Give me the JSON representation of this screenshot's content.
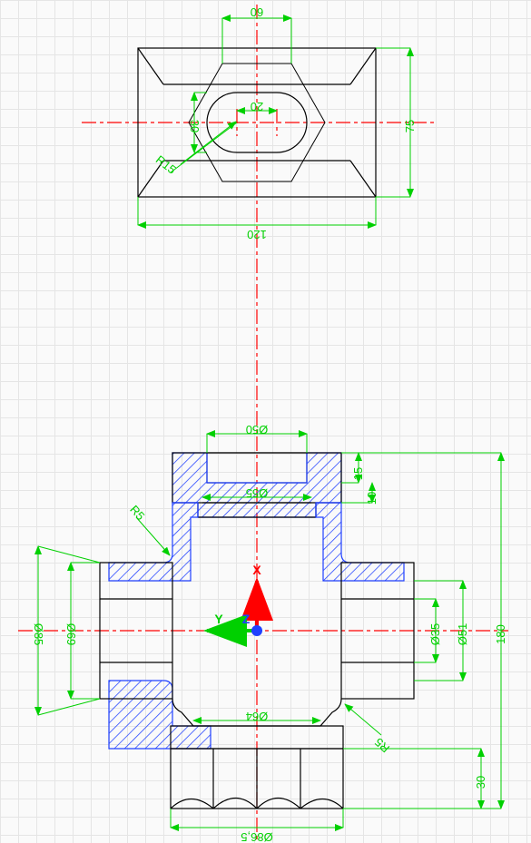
{
  "drawing": {
    "top_view": {
      "dims": {
        "width_120": "120",
        "height_75": "75",
        "hex_60": "60",
        "slot_30": "30",
        "slot_20": "20",
        "fillet_r15": "R15"
      }
    },
    "section_view": {
      "dims": {
        "dia_50": "Ø50",
        "dia_55": "Ø55",
        "dia_64": "Ø64",
        "dia_86_5": "Ø86,5",
        "dia_85": "Ø85",
        "dia_69": "Ø69",
        "dia_51": "Ø51",
        "dia_35": "Ø35",
        "height_180": "180",
        "step_15": "15",
        "step_10": "10",
        "step_30": "30",
        "fillet_r5_a": "R5",
        "fillet_r5_b": "R5"
      }
    },
    "ucs": {
      "x": "X",
      "y": "Y",
      "z": "Z"
    }
  }
}
